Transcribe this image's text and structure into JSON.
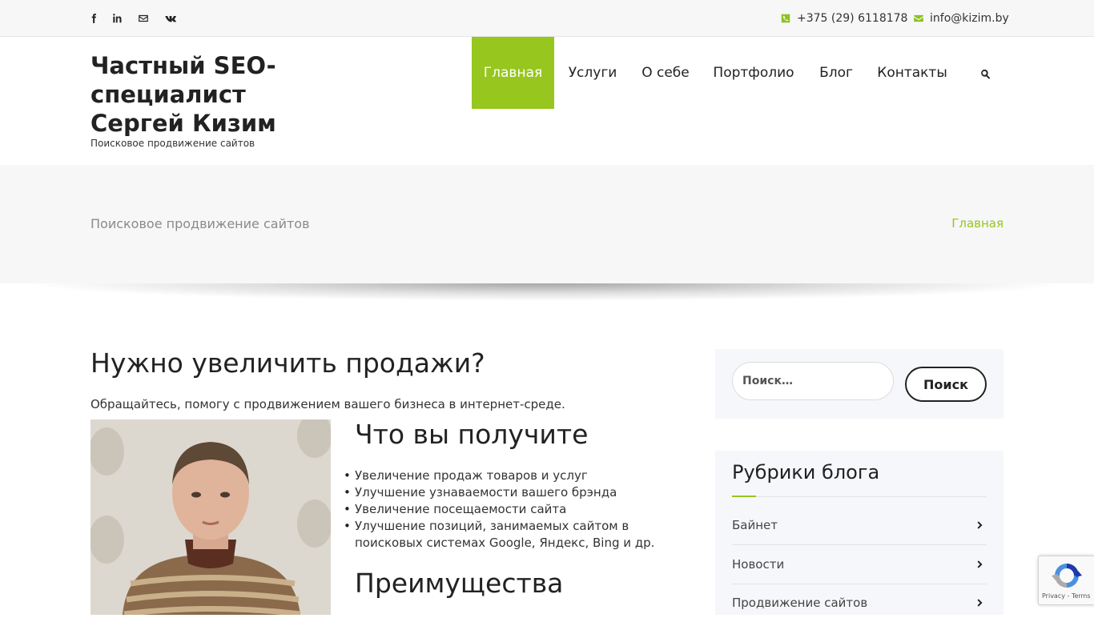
{
  "topbar": {
    "social": [
      {
        "name": "facebook-icon"
      },
      {
        "name": "linkedin-icon"
      },
      {
        "name": "email-icon"
      },
      {
        "name": "vk-icon"
      }
    ],
    "phone": "+375 (29) 6118178",
    "email": "info@kizim.by"
  },
  "site": {
    "title": "Частный SEO-специалист Сергей Кизим",
    "tagline": "Поисковое продвижение сайтов"
  },
  "nav": {
    "items": [
      {
        "label": "Главная",
        "active": true
      },
      {
        "label": "Услуги"
      },
      {
        "label": "О себе"
      },
      {
        "label": "Портфолио"
      },
      {
        "label": "Блог"
      },
      {
        "label": "Контакты"
      }
    ],
    "search_icon": "search-icon"
  },
  "page_band": {
    "title": "Поисковое продвижение сайтов",
    "breadcrumb": "Главная"
  },
  "main": {
    "heading": "Нужно увеличить продажи?",
    "lead": "Обращайтесь, помогу с продвижением вашего бизнеса в интернет-среде.",
    "section_title": "Что вы получите",
    "benefits": [
      "Увеличение продаж товаров и услуг",
      "Улучшение узнаваемости вашего брэнда",
      "Увеличение посещаемости сайта",
      "Улучшение позиций, занимаемых сайтом в поисковых системах Google, Яндекс, Bing и др."
    ],
    "advantages_title": "Преимущества"
  },
  "sidebar": {
    "search_placeholder": "Поиск…",
    "search_button": "Поиск",
    "categories_title": "Рубрики блога",
    "categories": [
      "Байнет",
      "Новости",
      "Продвижение сайтов"
    ]
  },
  "recaptcha": {
    "links": "Privacy - Terms"
  },
  "colors": {
    "accent": "#97c61e",
    "band": "#f7f7f7",
    "widget": "#f6f7fa"
  }
}
